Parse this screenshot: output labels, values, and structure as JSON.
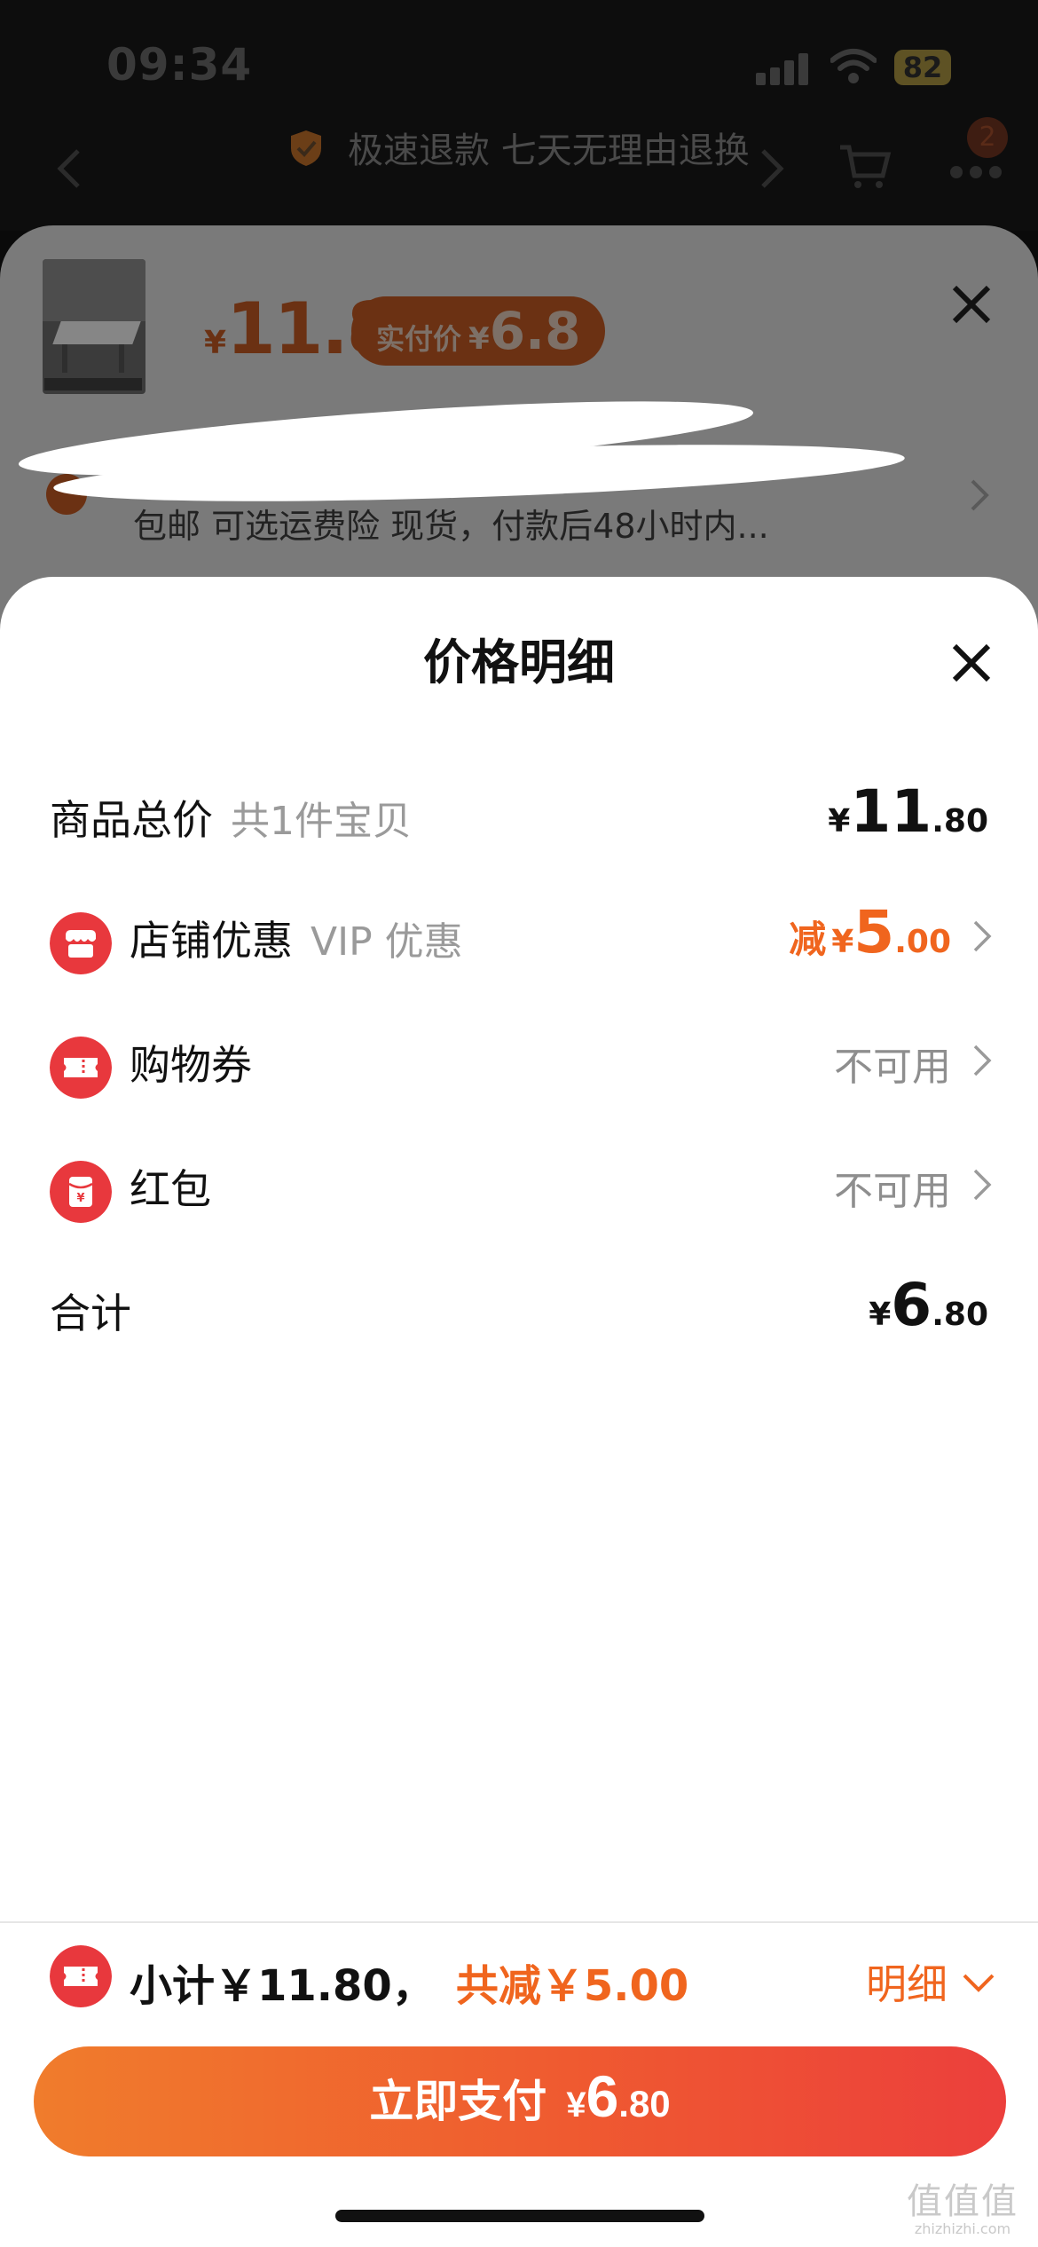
{
  "status_bar": {
    "time": "09:34",
    "battery": "82"
  },
  "background_page": {
    "refund_notice": "极速退款 七天无理由退换",
    "cart_badge": "2"
  },
  "product_sheet": {
    "price_symbol": "¥",
    "price": "11.8",
    "paid_label": "实付价",
    "paid_symbol": "¥",
    "paid_price": "6.8",
    "shipping_info": "包邮  可选运费险  现货，付款后48小时内..."
  },
  "price_detail": {
    "title": "价格明细",
    "rows": [
      {
        "label": "商品总价",
        "sub": "共1件宝贝",
        "symbol": "¥",
        "int": "11",
        "dec": ".80"
      },
      {
        "label": "店铺优惠",
        "sub": "VIP 优惠",
        "prefix": "减",
        "symbol": "¥",
        "int": "5",
        "dec": ".00"
      },
      {
        "label": "购物券",
        "value": "不可用"
      },
      {
        "label": "红包",
        "value": "不可用"
      },
      {
        "label": "合计",
        "symbol": "¥",
        "int": "6",
        "dec": ".80"
      }
    ]
  },
  "bottom_bar": {
    "subtotal_text": "小计￥11.80，",
    "discount_text": "共减￥5.00",
    "details_toggle": "明细",
    "pay_button": {
      "label": "立即支付",
      "symbol": "¥",
      "int": "6",
      "dec": ".80"
    }
  },
  "watermark": {
    "mark": "值值值",
    "url": "zhizhizhi.com"
  },
  "colors": {
    "accent": "#f0651e",
    "icon_red": "#e8383d",
    "pay_gradient_start": "#f07c2c",
    "pay_gradient_end": "#ec3f3c"
  }
}
